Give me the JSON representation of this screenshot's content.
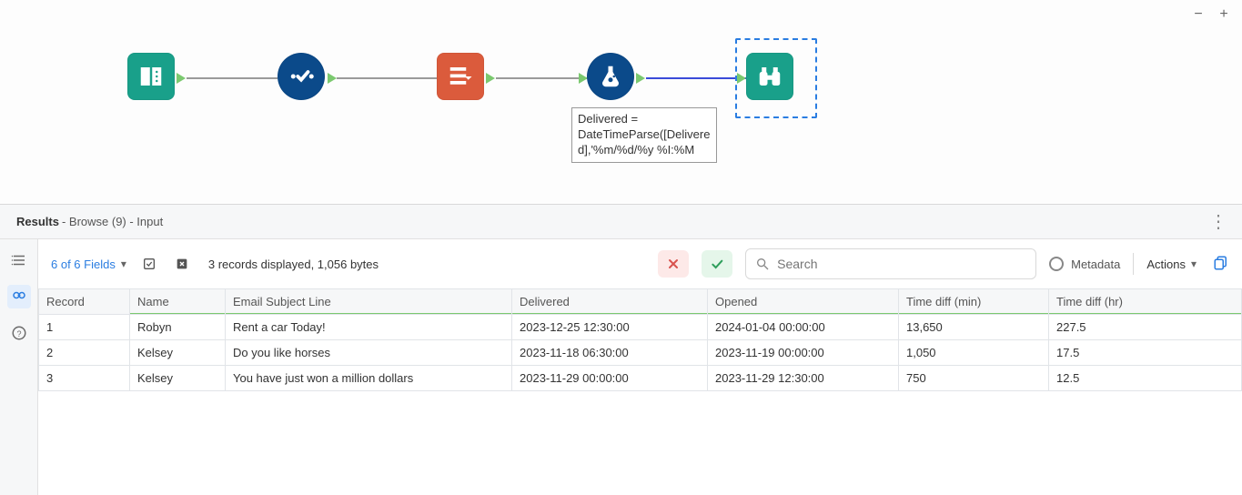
{
  "canvas": {
    "annotation": "Delivered = DateTimeParse([Delivered],'%m/%d/%y %I:%M",
    "tools": {
      "input": "input-tool",
      "select": "select-tool",
      "multirow": "multi-row-formula-tool",
      "formula": "formula-tool",
      "browse": "browse-tool"
    }
  },
  "results_header": {
    "title": "Results",
    "subtitle": " - Browse (9) - Input"
  },
  "toolbar": {
    "fields_label": "6 of 6 Fields",
    "status_text": "3 records displayed, 1,056 bytes",
    "search_placeholder": "Search",
    "metadata_label": "Metadata",
    "actions_label": "Actions"
  },
  "table": {
    "columns": [
      "Record",
      "Name",
      "Email Subject Line",
      "Delivered",
      "Opened",
      "Time diff (min)",
      "Time diff (hr)"
    ],
    "rows": [
      {
        "record": "1",
        "name": "Robyn",
        "subject": "Rent a car Today!",
        "delivered": "2023-12-25 12:30:00",
        "opened": "2024-01-04 00:00:00",
        "min": "13,650",
        "hr": "227.5"
      },
      {
        "record": "2",
        "name": "Kelsey",
        "subject": "Do you like horses",
        "delivered": "2023-11-18 06:30:00",
        "opened": "2023-11-19 00:00:00",
        "min": "1,050",
        "hr": "17.5"
      },
      {
        "record": "3",
        "name": "Kelsey",
        "subject": "You have just won a million dollars",
        "delivered": "2023-11-29 00:00:00",
        "opened": "2023-11-29 12:30:00",
        "min": "750",
        "hr": "12.5"
      }
    ]
  }
}
